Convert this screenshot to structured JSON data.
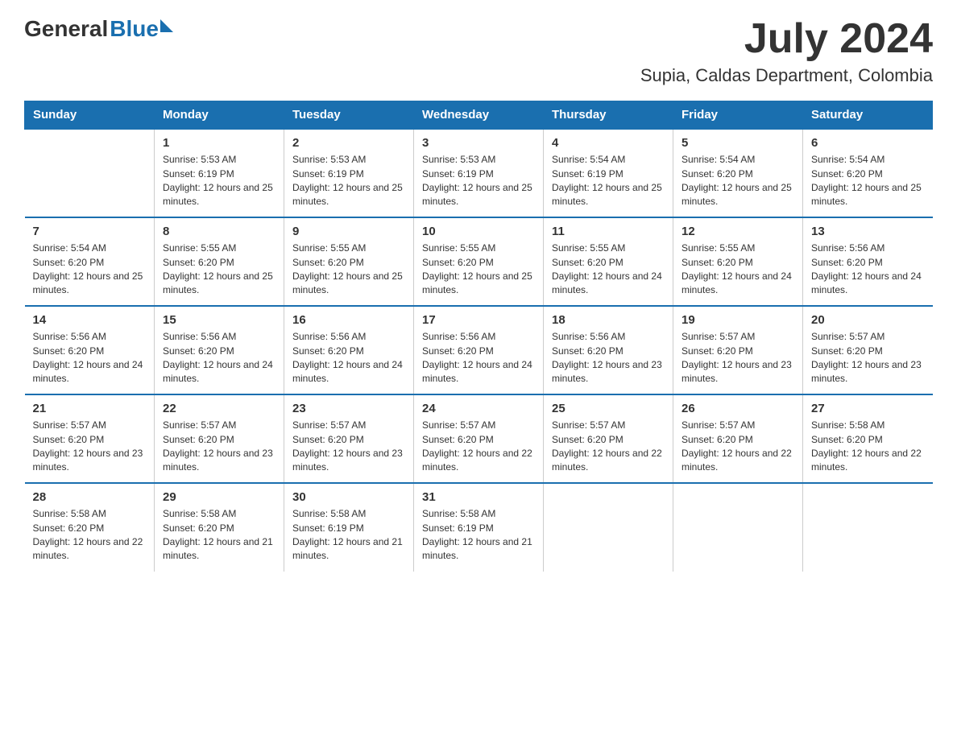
{
  "header": {
    "logo_general": "General",
    "logo_blue": "Blue",
    "month_title": "July 2024",
    "location": "Supia, Caldas Department, Colombia"
  },
  "days_of_week": [
    "Sunday",
    "Monday",
    "Tuesday",
    "Wednesday",
    "Thursday",
    "Friday",
    "Saturday"
  ],
  "weeks": [
    [
      {
        "day": "",
        "sunrise": "",
        "sunset": "",
        "daylight": ""
      },
      {
        "day": "1",
        "sunrise": "Sunrise: 5:53 AM",
        "sunset": "Sunset: 6:19 PM",
        "daylight": "Daylight: 12 hours and 25 minutes."
      },
      {
        "day": "2",
        "sunrise": "Sunrise: 5:53 AM",
        "sunset": "Sunset: 6:19 PM",
        "daylight": "Daylight: 12 hours and 25 minutes."
      },
      {
        "day": "3",
        "sunrise": "Sunrise: 5:53 AM",
        "sunset": "Sunset: 6:19 PM",
        "daylight": "Daylight: 12 hours and 25 minutes."
      },
      {
        "day": "4",
        "sunrise": "Sunrise: 5:54 AM",
        "sunset": "Sunset: 6:19 PM",
        "daylight": "Daylight: 12 hours and 25 minutes."
      },
      {
        "day": "5",
        "sunrise": "Sunrise: 5:54 AM",
        "sunset": "Sunset: 6:20 PM",
        "daylight": "Daylight: 12 hours and 25 minutes."
      },
      {
        "day": "6",
        "sunrise": "Sunrise: 5:54 AM",
        "sunset": "Sunset: 6:20 PM",
        "daylight": "Daylight: 12 hours and 25 minutes."
      }
    ],
    [
      {
        "day": "7",
        "sunrise": "Sunrise: 5:54 AM",
        "sunset": "Sunset: 6:20 PM",
        "daylight": "Daylight: 12 hours and 25 minutes."
      },
      {
        "day": "8",
        "sunrise": "Sunrise: 5:55 AM",
        "sunset": "Sunset: 6:20 PM",
        "daylight": "Daylight: 12 hours and 25 minutes."
      },
      {
        "day": "9",
        "sunrise": "Sunrise: 5:55 AM",
        "sunset": "Sunset: 6:20 PM",
        "daylight": "Daylight: 12 hours and 25 minutes."
      },
      {
        "day": "10",
        "sunrise": "Sunrise: 5:55 AM",
        "sunset": "Sunset: 6:20 PM",
        "daylight": "Daylight: 12 hours and 25 minutes."
      },
      {
        "day": "11",
        "sunrise": "Sunrise: 5:55 AM",
        "sunset": "Sunset: 6:20 PM",
        "daylight": "Daylight: 12 hours and 24 minutes."
      },
      {
        "day": "12",
        "sunrise": "Sunrise: 5:55 AM",
        "sunset": "Sunset: 6:20 PM",
        "daylight": "Daylight: 12 hours and 24 minutes."
      },
      {
        "day": "13",
        "sunrise": "Sunrise: 5:56 AM",
        "sunset": "Sunset: 6:20 PM",
        "daylight": "Daylight: 12 hours and 24 minutes."
      }
    ],
    [
      {
        "day": "14",
        "sunrise": "Sunrise: 5:56 AM",
        "sunset": "Sunset: 6:20 PM",
        "daylight": "Daylight: 12 hours and 24 minutes."
      },
      {
        "day": "15",
        "sunrise": "Sunrise: 5:56 AM",
        "sunset": "Sunset: 6:20 PM",
        "daylight": "Daylight: 12 hours and 24 minutes."
      },
      {
        "day": "16",
        "sunrise": "Sunrise: 5:56 AM",
        "sunset": "Sunset: 6:20 PM",
        "daylight": "Daylight: 12 hours and 24 minutes."
      },
      {
        "day": "17",
        "sunrise": "Sunrise: 5:56 AM",
        "sunset": "Sunset: 6:20 PM",
        "daylight": "Daylight: 12 hours and 24 minutes."
      },
      {
        "day": "18",
        "sunrise": "Sunrise: 5:56 AM",
        "sunset": "Sunset: 6:20 PM",
        "daylight": "Daylight: 12 hours and 23 minutes."
      },
      {
        "day": "19",
        "sunrise": "Sunrise: 5:57 AM",
        "sunset": "Sunset: 6:20 PM",
        "daylight": "Daylight: 12 hours and 23 minutes."
      },
      {
        "day": "20",
        "sunrise": "Sunrise: 5:57 AM",
        "sunset": "Sunset: 6:20 PM",
        "daylight": "Daylight: 12 hours and 23 minutes."
      }
    ],
    [
      {
        "day": "21",
        "sunrise": "Sunrise: 5:57 AM",
        "sunset": "Sunset: 6:20 PM",
        "daylight": "Daylight: 12 hours and 23 minutes."
      },
      {
        "day": "22",
        "sunrise": "Sunrise: 5:57 AM",
        "sunset": "Sunset: 6:20 PM",
        "daylight": "Daylight: 12 hours and 23 minutes."
      },
      {
        "day": "23",
        "sunrise": "Sunrise: 5:57 AM",
        "sunset": "Sunset: 6:20 PM",
        "daylight": "Daylight: 12 hours and 23 minutes."
      },
      {
        "day": "24",
        "sunrise": "Sunrise: 5:57 AM",
        "sunset": "Sunset: 6:20 PM",
        "daylight": "Daylight: 12 hours and 22 minutes."
      },
      {
        "day": "25",
        "sunrise": "Sunrise: 5:57 AM",
        "sunset": "Sunset: 6:20 PM",
        "daylight": "Daylight: 12 hours and 22 minutes."
      },
      {
        "day": "26",
        "sunrise": "Sunrise: 5:57 AM",
        "sunset": "Sunset: 6:20 PM",
        "daylight": "Daylight: 12 hours and 22 minutes."
      },
      {
        "day": "27",
        "sunrise": "Sunrise: 5:58 AM",
        "sunset": "Sunset: 6:20 PM",
        "daylight": "Daylight: 12 hours and 22 minutes."
      }
    ],
    [
      {
        "day": "28",
        "sunrise": "Sunrise: 5:58 AM",
        "sunset": "Sunset: 6:20 PM",
        "daylight": "Daylight: 12 hours and 22 minutes."
      },
      {
        "day": "29",
        "sunrise": "Sunrise: 5:58 AM",
        "sunset": "Sunset: 6:20 PM",
        "daylight": "Daylight: 12 hours and 21 minutes."
      },
      {
        "day": "30",
        "sunrise": "Sunrise: 5:58 AM",
        "sunset": "Sunset: 6:19 PM",
        "daylight": "Daylight: 12 hours and 21 minutes."
      },
      {
        "day": "31",
        "sunrise": "Sunrise: 5:58 AM",
        "sunset": "Sunset: 6:19 PM",
        "daylight": "Daylight: 12 hours and 21 minutes."
      },
      {
        "day": "",
        "sunrise": "",
        "sunset": "",
        "daylight": ""
      },
      {
        "day": "",
        "sunrise": "",
        "sunset": "",
        "daylight": ""
      },
      {
        "day": "",
        "sunrise": "",
        "sunset": "",
        "daylight": ""
      }
    ]
  ]
}
